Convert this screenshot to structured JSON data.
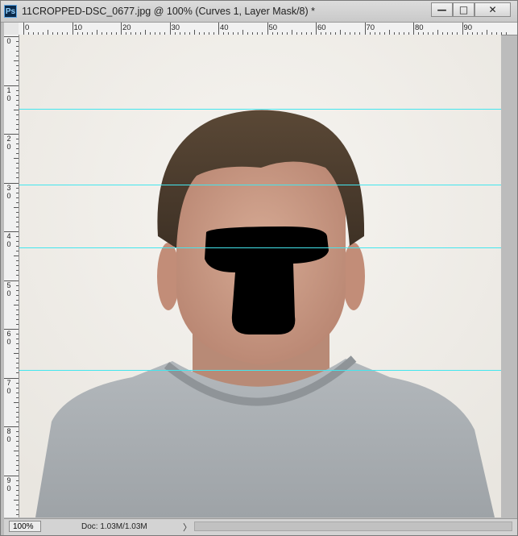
{
  "window": {
    "app_icon_text": "Ps",
    "title": "11CROPPED-DSC_0677.jpg @ 100% (Curves 1, Layer Mask/8) *",
    "minimize_glyph": "—",
    "maximize_glyph": "□",
    "close_glyph": "✕"
  },
  "rulers": {
    "horizontal_labels": [
      "0",
      "10",
      "20",
      "30",
      "40",
      "50",
      "60",
      "70",
      "80",
      "90"
    ],
    "vertical_labels": [
      [
        "0"
      ],
      [
        "1",
        "0"
      ],
      [
        "2",
        "0"
      ],
      [
        "3",
        "0"
      ],
      [
        "4",
        "0"
      ],
      [
        "5",
        "0"
      ],
      [
        "6",
        "0"
      ],
      [
        "7",
        "0"
      ],
      [
        "8",
        "0"
      ],
      [
        "9",
        "0"
      ]
    ]
  },
  "canvas": {
    "background_color": "#f0eeea",
    "guide_color": "#43e6ee",
    "mask_color": "#000000",
    "shirt_color": "#a9aeb2",
    "skin_color": "#c99a84",
    "hair_color": "#4a3b2c"
  },
  "status": {
    "zoom": "100%",
    "doc_info": "Doc: 1.03M/1.03M",
    "arrow": "〉"
  }
}
